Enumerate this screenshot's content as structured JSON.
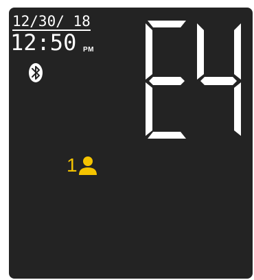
{
  "display": {
    "date": "12/30/ 18",
    "time": "12:50",
    "ampm": "PM",
    "error_code": "E4",
    "user_number": "1"
  },
  "icons": {
    "bluetooth": "bluetooth-icon",
    "user": "user-icon"
  },
  "colors": {
    "screen_bg": "#232323",
    "segment": "#ffffff",
    "user_accent": "#f5c400"
  }
}
